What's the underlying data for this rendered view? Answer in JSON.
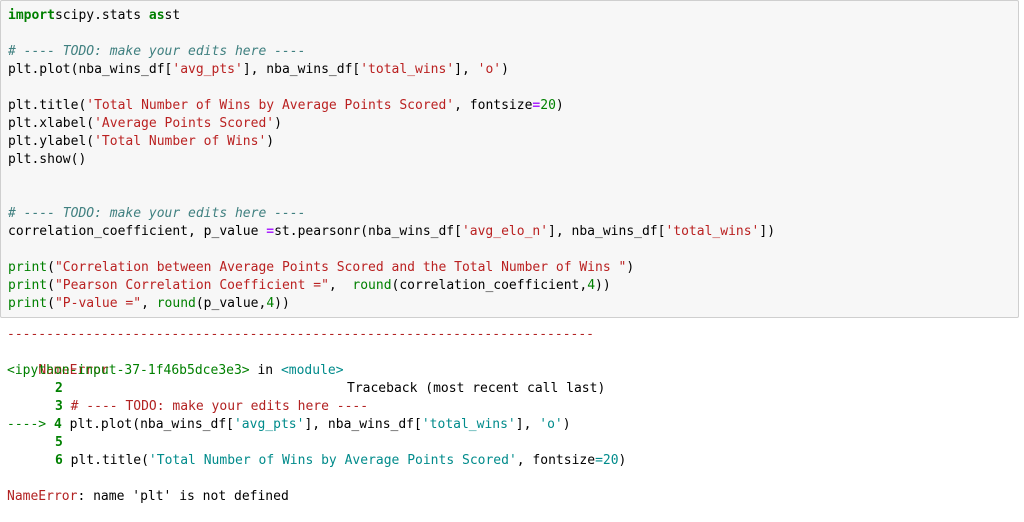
{
  "input_cell": {
    "lines": [
      {
        "k": "l0",
        "parts": [
          [
            "kw",
            "import"
          ],
          [
            "",
            "scipy.stats "
          ],
          [
            "kw",
            "as"
          ],
          [
            "",
            "st"
          ]
        ]
      },
      {
        "k": "l1",
        "parts": [
          [
            "cm",
            "# ---- TODO: make your edits here ----"
          ]
        ]
      },
      {
        "k": "l2",
        "parts": [
          [
            "",
            "plt.plot(nba_wins_df["
          ],
          [
            "str",
            "'avg_pts'"
          ],
          [
            "",
            "], nba_wins_df["
          ],
          [
            "str",
            "'total_wins'"
          ],
          [
            "",
            "], "
          ],
          [
            "str",
            "'o'"
          ],
          [
            "",
            ")"
          ]
        ]
      },
      {
        "k": "l3",
        "parts": [
          [
            "",
            "plt.title("
          ],
          [
            "str",
            "'Total Number of Wins by Average Points Scored'"
          ],
          [
            "",
            ", fontsize"
          ],
          [
            "op",
            "="
          ],
          [
            "num",
            "20"
          ],
          [
            "",
            ")"
          ]
        ]
      },
      {
        "k": "l4",
        "parts": [
          [
            "",
            "plt.xlabel("
          ],
          [
            "str",
            "'Average Points Scored'"
          ],
          [
            "",
            ")"
          ]
        ]
      },
      {
        "k": "l5",
        "parts": [
          [
            "",
            "plt.ylabel("
          ],
          [
            "str",
            "'Total Number of Wins'"
          ],
          [
            "",
            ")"
          ]
        ]
      },
      {
        "k": "l6",
        "parts": [
          [
            "",
            "plt.show()"
          ]
        ]
      },
      {
        "k": "l7",
        "parts": [
          [
            "cm",
            "# ---- TODO: make your edits here ----"
          ]
        ]
      },
      {
        "k": "l8",
        "parts": [
          [
            "",
            "correlation_coefficient, p_value "
          ],
          [
            "op",
            "="
          ],
          [
            "",
            ""
          ],
          [
            "",
            "st.pearsonr(nba_wins_df["
          ],
          [
            "str",
            "'avg_elo_n'"
          ],
          [
            "",
            "], nba_wins_df["
          ],
          [
            "str",
            "'total_wins'"
          ],
          [
            "",
            "])"
          ]
        ]
      },
      {
        "k": "l9",
        "parts": [
          [
            "builtin",
            "print"
          ],
          [
            "",
            "("
          ],
          [
            "str",
            "\"Correlation between Average Points Scored and the Total Number of Wins \""
          ],
          [
            "",
            ")"
          ]
        ]
      },
      {
        "k": "l10",
        "parts": [
          [
            "builtin",
            "print"
          ],
          [
            "",
            "("
          ],
          [
            "str",
            "\"Pearson Correlation Coefficient =\""
          ],
          [
            "",
            ",  "
          ],
          [
            "builtin",
            "round"
          ],
          [
            "",
            "(correlation_coefficient,"
          ],
          [
            "num",
            "4"
          ],
          [
            "",
            "))"
          ]
        ]
      },
      {
        "k": "l11",
        "parts": [
          [
            "builtin",
            "print"
          ],
          [
            "",
            "("
          ],
          [
            "str",
            "\"P-value =\""
          ],
          [
            "",
            ", "
          ],
          [
            "builtin",
            "round"
          ],
          [
            "",
            "(p_value,"
          ],
          [
            "num",
            "4"
          ],
          [
            "",
            "))"
          ]
        ]
      }
    ]
  },
  "output": {
    "separator": "---------------------------------------------------------------------------",
    "error_name": "NameError",
    "traceback_label": "Traceback (most recent call last)",
    "input_ref": "<ipython-input-37-1f46b5dce3e3>",
    "in_text": " in ",
    "module_ref": "<module>",
    "tb2_no": "2",
    "tb3_no": "3",
    "tb3_code": " # ---- TODO: make your edits here ----",
    "tb4_arrow": "----> ",
    "tb4_no": "4",
    "tb4_a": " plt.plot(nba_wins_df[",
    "tb4_s1": "'avg_pts'",
    "tb4_b": "], nba_wins_df[",
    "tb4_s2": "'total_wins'",
    "tb4_c": "], ",
    "tb4_s3": "'o'",
    "tb4_d": ")",
    "tb5_no": "5",
    "tb6_no": "6",
    "tb6_a": " plt.title(",
    "tb6_s1": "'Total Number of Wins by Average Points Scored'",
    "tb6_b": ", fontsize",
    "tb6_eq": "=",
    "tb6_n": "20",
    "tb6_c": ")",
    "final_error_name": "NameError",
    "final_error_msg": ": name 'plt' is not defined"
  }
}
